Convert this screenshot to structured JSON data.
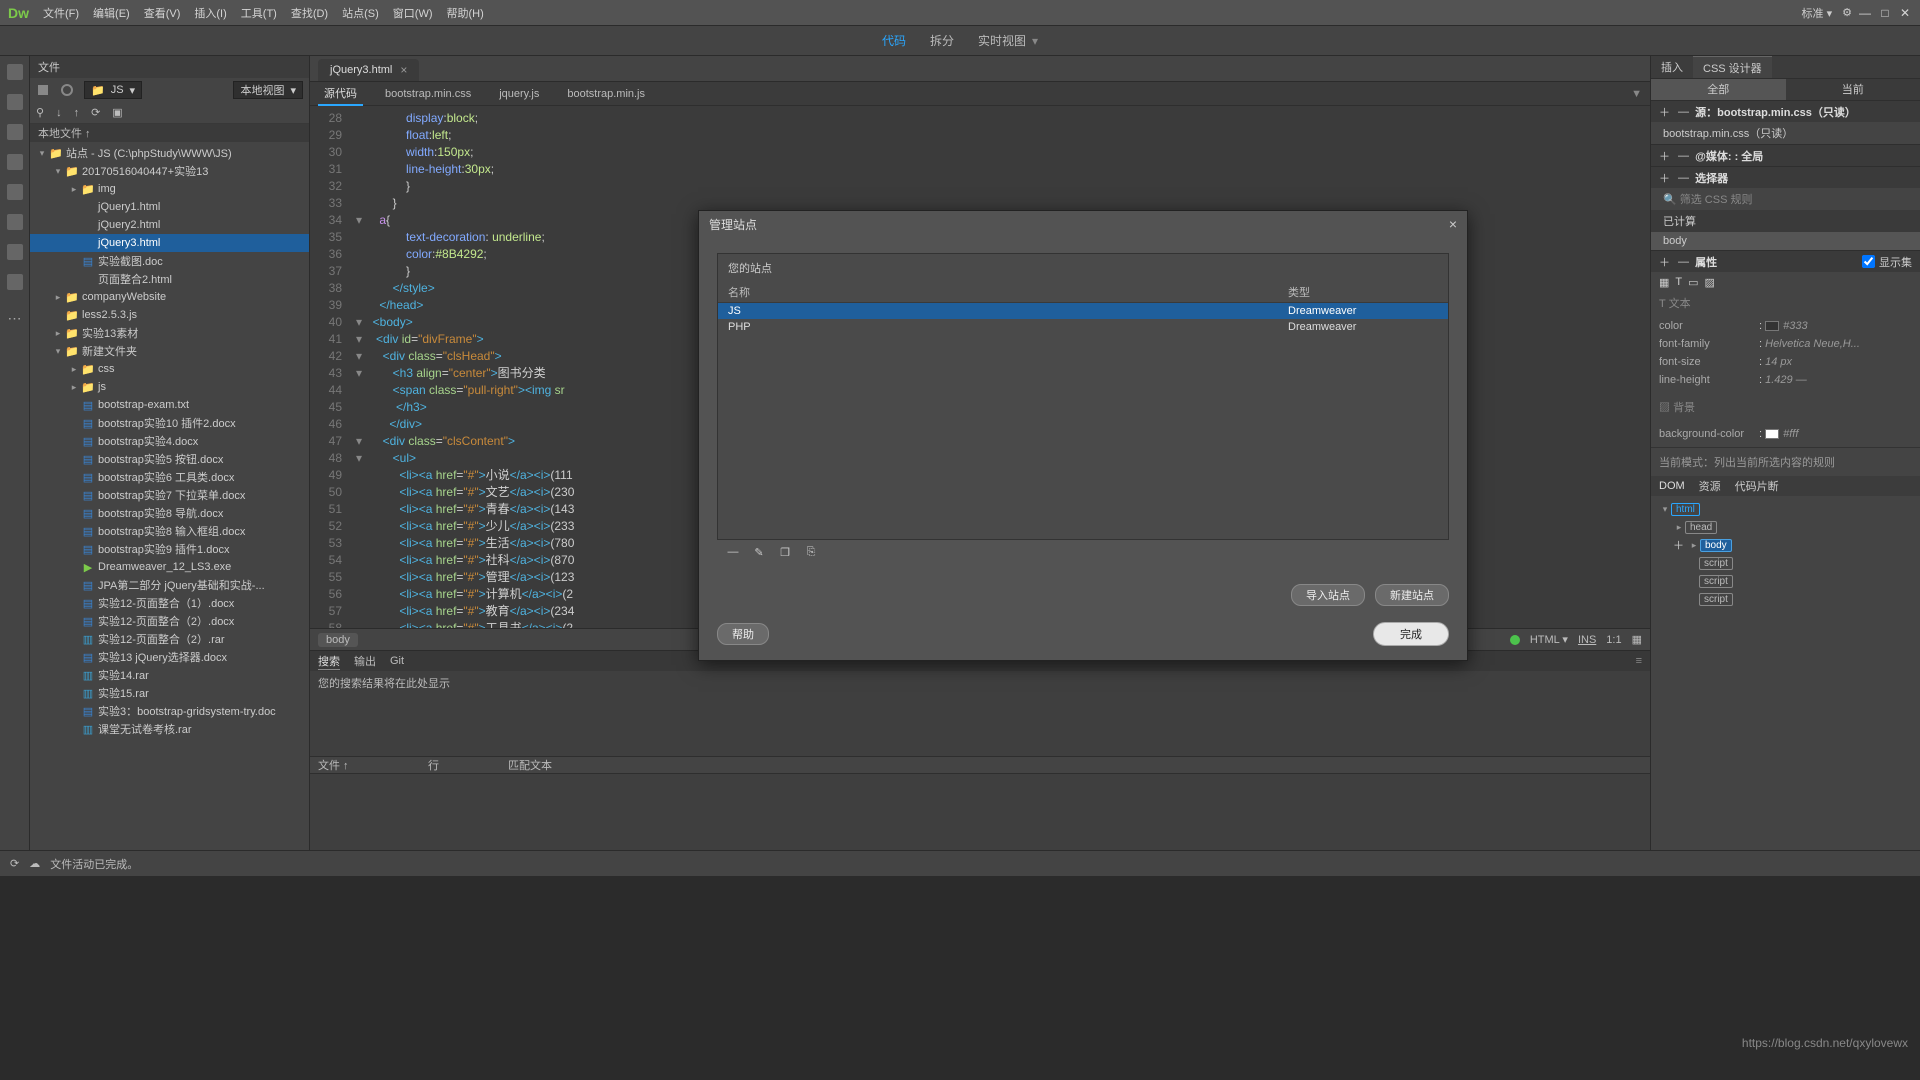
{
  "menubar": {
    "logo": "Dw",
    "items": [
      "文件(F)",
      "编辑(E)",
      "查看(V)",
      "插入(I)",
      "工具(T)",
      "查找(D)",
      "站点(S)",
      "窗口(W)",
      "帮助(H)"
    ],
    "mode": "标准 ▾"
  },
  "toolbar2": {
    "code": "代码",
    "split": "拆分",
    "live": "实时视图"
  },
  "filesPanel": {
    "title": "文件",
    "dropdown_site": "JS",
    "dropdown_view": "本地视图",
    "columns_header": "本地文件 ↑",
    "tree": [
      {
        "d": 0,
        "tw": "▾",
        "ic": "folder",
        "lbl": "站点 - JS (C:\\phpStudy\\WWW\\JS)"
      },
      {
        "d": 1,
        "tw": "▾",
        "ic": "folder",
        "lbl": "20170516040447+实验13"
      },
      {
        "d": 2,
        "tw": "▸",
        "ic": "folder",
        "lbl": "img"
      },
      {
        "d": 2,
        "tw": "",
        "ic": "html",
        "lbl": "jQuery1.html"
      },
      {
        "d": 2,
        "tw": "",
        "ic": "html",
        "lbl": "jQuery2.html"
      },
      {
        "d": 2,
        "tw": "",
        "ic": "html",
        "lbl": "jQuery3.html",
        "sel": true
      },
      {
        "d": 2,
        "tw": "",
        "ic": "word",
        "lbl": "实验截图.doc"
      },
      {
        "d": 2,
        "tw": "",
        "ic": "html",
        "lbl": "页面整合2.html"
      },
      {
        "d": 1,
        "tw": "▸",
        "ic": "folder",
        "lbl": "companyWebsite"
      },
      {
        "d": 1,
        "tw": "",
        "ic": "folder",
        "lbl": "less2.5.3.js"
      },
      {
        "d": 1,
        "tw": "▸",
        "ic": "folder",
        "lbl": "实验13素材"
      },
      {
        "d": 1,
        "tw": "▾",
        "ic": "folder",
        "lbl": "新建文件夹"
      },
      {
        "d": 2,
        "tw": "▸",
        "ic": "folder",
        "lbl": "css"
      },
      {
        "d": 2,
        "tw": "▸",
        "ic": "folder",
        "lbl": "js"
      },
      {
        "d": 2,
        "tw": "",
        "ic": "word",
        "lbl": "bootstrap-exam.txt"
      },
      {
        "d": 2,
        "tw": "",
        "ic": "word",
        "lbl": "bootstrap实验10 插件2.docx"
      },
      {
        "d": 2,
        "tw": "",
        "ic": "word",
        "lbl": "bootstrap实验4.docx"
      },
      {
        "d": 2,
        "tw": "",
        "ic": "word",
        "lbl": "bootstrap实验5 按钮.docx"
      },
      {
        "d": 2,
        "tw": "",
        "ic": "word",
        "lbl": "bootstrap实验6 工具类.docx"
      },
      {
        "d": 2,
        "tw": "",
        "ic": "word",
        "lbl": "bootstrap实验7 下拉菜单.docx"
      },
      {
        "d": 2,
        "tw": "",
        "ic": "word",
        "lbl": "bootstrap实验8 导航.docx"
      },
      {
        "d": 2,
        "tw": "",
        "ic": "word",
        "lbl": "bootstrap实验8 输入框组.docx"
      },
      {
        "d": 2,
        "tw": "",
        "ic": "word",
        "lbl": "bootstrap实验9 插件1.docx"
      },
      {
        "d": 2,
        "tw": "",
        "ic": "exe",
        "lbl": "Dreamweaver_12_LS3.exe"
      },
      {
        "d": 2,
        "tw": "",
        "ic": "word",
        "lbl": "JPA第二部分 jQuery基础和实战-..."
      },
      {
        "d": 2,
        "tw": "",
        "ic": "word",
        "lbl": "实验12-页面整合（1）.docx"
      },
      {
        "d": 2,
        "tw": "",
        "ic": "word",
        "lbl": "实验12-页面整合（2）.docx"
      },
      {
        "d": 2,
        "tw": "",
        "ic": "rar",
        "lbl": "实验12-页面整合（2）.rar"
      },
      {
        "d": 2,
        "tw": "",
        "ic": "word",
        "lbl": "实验13 jQuery选择器.docx"
      },
      {
        "d": 2,
        "tw": "",
        "ic": "rar",
        "lbl": "实验14.rar"
      },
      {
        "d": 2,
        "tw": "",
        "ic": "rar",
        "lbl": "实验15.rar"
      },
      {
        "d": 2,
        "tw": "",
        "ic": "word",
        "lbl": "实验3：bootstrap-gridsystem-try.doc"
      },
      {
        "d": 2,
        "tw": "",
        "ic": "rar",
        "lbl": "课堂无试卷考核.rar"
      }
    ]
  },
  "editor": {
    "tab": "jQuery3.html",
    "subtabs": [
      "源代码",
      "bootstrap.min.css",
      "jquery.js",
      "bootstrap.min.js"
    ],
    "status": {
      "crumb": "body",
      "lang": "HTML",
      "ins": "INS",
      "pos": "1:1"
    }
  },
  "output": {
    "tabs": [
      "搜索",
      "输出",
      "Git"
    ],
    "msg": "您的搜索结果将在此处显示",
    "cols": [
      "文件 ↑",
      "行",
      "匹配文本"
    ]
  },
  "rightPanel": {
    "tabs": [
      "插入",
      "CSS 设计器"
    ],
    "scopeTabs": [
      "全部",
      "当前"
    ],
    "source_label": "源：bootstrap.min.css（只读）",
    "source_item": "bootstrap.min.css（只读）",
    "media_label": "@媒体: : 全局",
    "selectors_label": "选择器",
    "computed": "已计算",
    "computed_target": "body",
    "props_label": "属性",
    "show_set": "显示集",
    "props": [
      {
        "k": "color",
        "v": "#333"
      },
      {
        "k": "font-family",
        "v": "Helvetica Neue,H..."
      },
      {
        "k": "font-size",
        "v": "14 px"
      },
      {
        "k": "line-height",
        "v": "1.429 —"
      }
    ],
    "bg_label": "背景",
    "bg_prop": "background-color",
    "bg_val": "#fff",
    "mode_hint": "当前模式：列出当前所选内容的规则",
    "domTabs": [
      "DOM",
      "资源",
      "代码片断"
    ],
    "dom": [
      "html",
      "head",
      "body",
      "script",
      "script",
      "script"
    ]
  },
  "bottomBar": {
    "msg": "文件活动已完成。",
    "watermark": "https://blog.csdn.net/qxylovewx"
  },
  "dialog": {
    "title": "管理站点",
    "yourSites": "您的站点",
    "col_name": "名称",
    "col_type": "类型",
    "rows": [
      {
        "name": "JS",
        "type": "Dreamweaver",
        "sel": true
      },
      {
        "name": "PHP",
        "type": "Dreamweaver"
      }
    ],
    "btn_import": "导入站点",
    "btn_new": "新建站点",
    "btn_help": "帮助",
    "btn_done": "完成"
  }
}
